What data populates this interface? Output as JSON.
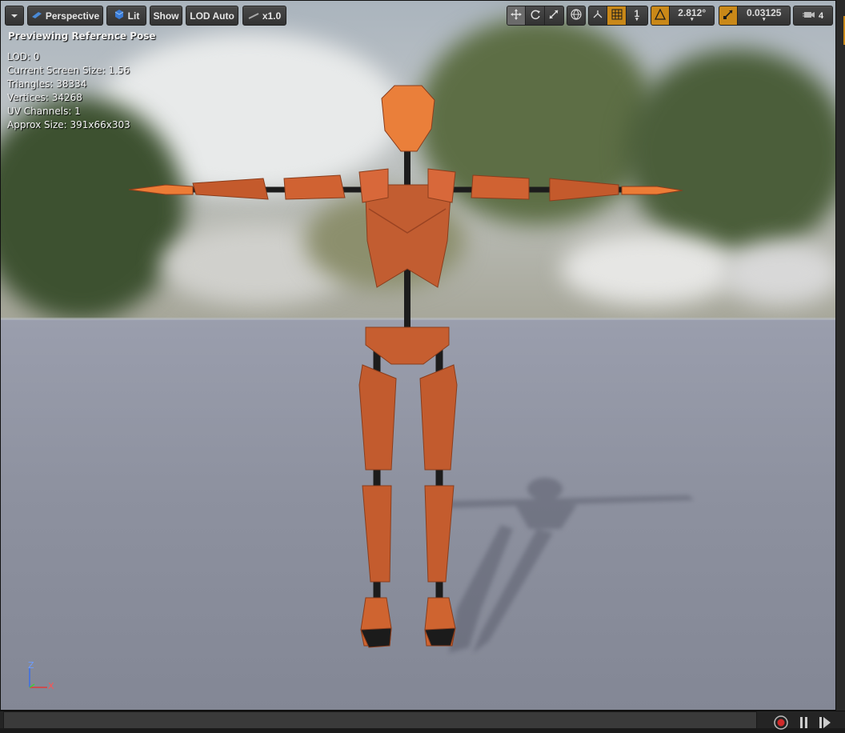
{
  "toolbar": {
    "menu_icon": "chevron-down-icon",
    "perspective_label": "Perspective",
    "lit_label": "Lit",
    "show_label": "Show",
    "lod_label": "LOD Auto",
    "speed_label": "x1.0",
    "camera_speed_value": "1",
    "rotation_snap_value": "2.812°",
    "scale_snap_value": "0.03125",
    "camera_speed_count": "4"
  },
  "viewport": {
    "preview_label": "Previewing Reference Pose",
    "stats": [
      "LOD: 0",
      "Current Screen Size: 1.56",
      "Triangles: 38334",
      "Vertices: 34268",
      "UV Channels: 1",
      "Approx Size: 391x66x303"
    ],
    "axis": {
      "z": "Z",
      "x": "X"
    }
  },
  "colors": {
    "accent": "#c98818",
    "mannequin": "#c05a2e",
    "joint": "#1c1c1c"
  }
}
